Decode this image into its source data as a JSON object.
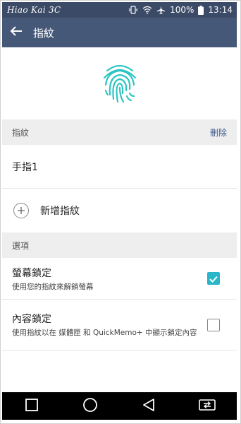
{
  "status_bar": {
    "watermark": "Hiao Kai 3C",
    "battery": "100%",
    "time": "13:14"
  },
  "app_bar": {
    "title": "指紋"
  },
  "fingerprints": {
    "header": "指紋",
    "delete_label": "刪除",
    "items": [
      {
        "label": "手指1"
      }
    ],
    "add_label": "新增指紋"
  },
  "options": {
    "header": "選項",
    "items": [
      {
        "title": "螢幕鎖定",
        "subtitle": "使用您的指紋來解鎖螢幕",
        "checked": true
      },
      {
        "title": "內容鎖定",
        "subtitle": "使用指紋以在 媒體匣 和 QuickMemo+ 中顯示鎖定內容",
        "checked": false
      }
    ]
  },
  "colors": {
    "status_bar": "#3b4a66",
    "app_bar": "#465878",
    "accent": "#29b6c8"
  }
}
